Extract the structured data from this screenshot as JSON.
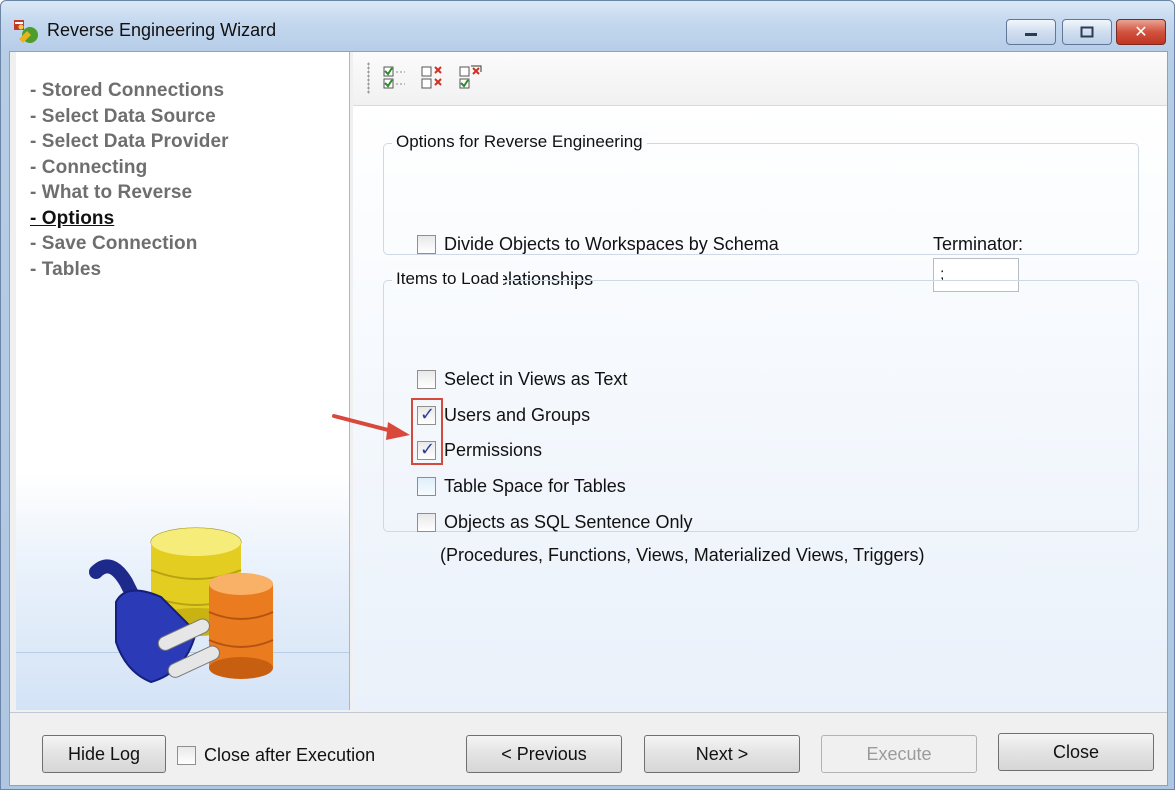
{
  "window": {
    "title": "Reverse Engineering Wizard",
    "minimize_label": "▭",
    "maximize_label": "▢",
    "close_label": "✕"
  },
  "sidebar": {
    "steps": [
      {
        "label": "- Stored Connections"
      },
      {
        "label": "- Select Data Source"
      },
      {
        "label": "- Select Data Provider"
      },
      {
        "label": "- Connecting"
      },
      {
        "label": "- What to Reverse"
      },
      {
        "label": "- Options",
        "active": true
      },
      {
        "label": "- Save Connection"
      },
      {
        "label": "- Tables"
      }
    ]
  },
  "toolbar": {
    "buttons": [
      {
        "icon": "check-all-icon"
      },
      {
        "icon": "uncheck-all-icon"
      },
      {
        "icon": "invert-selection-icon"
      }
    ]
  },
  "options_group": {
    "legend": "Options for Reverse Engineering",
    "divide_objects": {
      "label": "Divide Objects to Workspaces by Schema",
      "checked": false
    },
    "infer_relationships": {
      "label": "Infer Relationships",
      "checked": false
    },
    "terminator_label": "Terminator:",
    "terminator_value": ";"
  },
  "items_group": {
    "legend": "Items to Load",
    "select_in_views": {
      "label": "Select in Views as Text",
      "checked": false
    },
    "users_groups": {
      "label": "Users and Groups",
      "checked": true
    },
    "permissions": {
      "label": "Permissions",
      "checked": true
    },
    "table_space": {
      "label": "Table Space for Tables",
      "checked": false
    },
    "objects_sql": {
      "label": "Objects as SQL Sentence Only",
      "checked": false
    },
    "objects_sql_note": "(Procedures, Functions, Views, Materialized Views, Triggers)"
  },
  "footer": {
    "hide_log": "Hide Log",
    "close_after_execution": {
      "label": "Close after Execution",
      "checked": false
    },
    "previous": "< Previous",
    "next": "Next >",
    "execute": "Execute",
    "close": "Close"
  },
  "colors": {
    "highlight_box": "#d24b3e",
    "arrow": "#d9493b",
    "check_mark": "#2a3f9a"
  }
}
